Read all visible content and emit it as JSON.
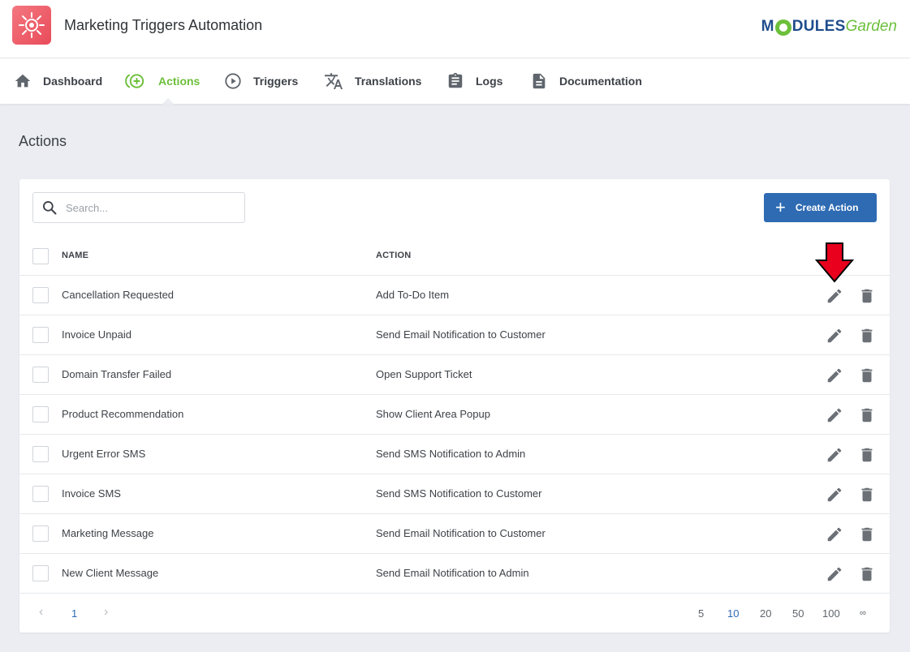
{
  "app": {
    "title": "Marketing Triggers Automation",
    "brand_part1": "M",
    "brand_part2": "DULES",
    "brand_part3": "Garden"
  },
  "nav": [
    {
      "label": "Dashboard",
      "icon": "home-icon"
    },
    {
      "label": "Actions",
      "icon": "add-circle-icon",
      "active": true
    },
    {
      "label": "Triggers",
      "icon": "play-circle-icon"
    },
    {
      "label": "Translations",
      "icon": "translate-icon"
    },
    {
      "label": "Logs",
      "icon": "clipboard-icon"
    },
    {
      "label": "Documentation",
      "icon": "document-icon"
    }
  ],
  "page": {
    "title": "Actions"
  },
  "toolbar": {
    "search_placeholder": "Search...",
    "create_label": "Create Action"
  },
  "table": {
    "columns": [
      "NAME",
      "ACTION"
    ],
    "rows": [
      {
        "name": "Cancellation Requested",
        "action": "Add To-Do Item"
      },
      {
        "name": "Invoice Unpaid",
        "action": "Send Email Notification to Customer"
      },
      {
        "name": "Domain Transfer Failed",
        "action": "Open Support Ticket"
      },
      {
        "name": "Product Recommendation",
        "action": "Show Client Area Popup"
      },
      {
        "name": "Urgent Error SMS",
        "action": "Send SMS Notification to Admin"
      },
      {
        "name": "Invoice SMS",
        "action": "Send SMS Notification to Customer"
      },
      {
        "name": "Marketing Message",
        "action": "Send Email Notification to Customer"
      },
      {
        "name": "New Client Message",
        "action": "Send Email Notification to Admin"
      }
    ]
  },
  "pagination": {
    "prev": "‹",
    "current_page": "1",
    "next": "›",
    "page_sizes": [
      "5",
      "10",
      "20",
      "50",
      "100",
      "∞"
    ],
    "selected_size": "10"
  },
  "colors": {
    "accent_green": "#6cbf3b",
    "primary_blue": "#2e6bb3",
    "arrow_red": "#e8001c"
  }
}
